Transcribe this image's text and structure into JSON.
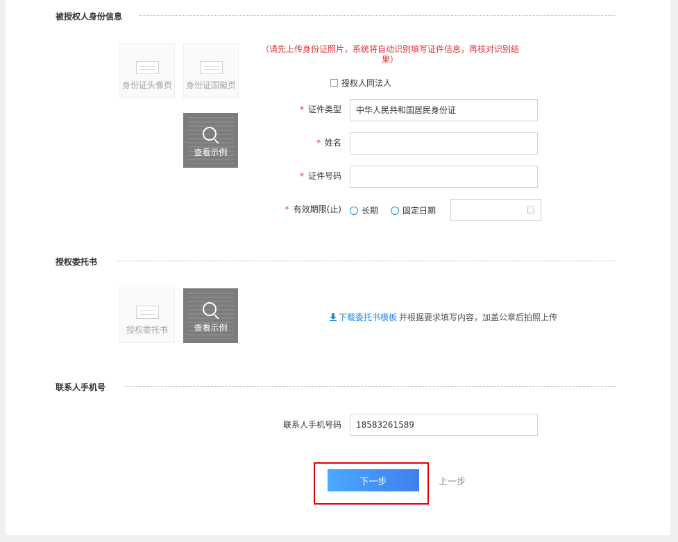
{
  "sections": {
    "authorized_person": "被授权人身份信息",
    "authorization_letter": "授权委托书",
    "contact_phone": "联系人手机号"
  },
  "id_upload": {
    "front_label": "身份证头像页",
    "back_label": "身份证国徽页",
    "example_label": "查看示例",
    "hint": "（请先上传身份证照片，系统将自动识别填写证件信息，再核对识别结果）"
  },
  "form": {
    "same_as_legal_label": "授权人同法人",
    "required_mark": "*",
    "id_type_label": "证件类型",
    "id_type_value": "中华人民共和国居民身份证",
    "name_label": "姓名",
    "name_value": "",
    "id_number_label": "证件号码",
    "id_number_value": "",
    "validity_label": "有效期限(止)",
    "validity_options": [
      "长期",
      "固定日期"
    ],
    "validity_date": ""
  },
  "letter_upload": {
    "upload_label": "授权委托书",
    "example_label": "查看示例",
    "download_link": "下载委托书模板",
    "download_hint": "并根据要求填写内容，加盖公章后拍照上传"
  },
  "contact": {
    "phone_label": "联系人手机号码",
    "phone_value": "18583261589"
  },
  "actions": {
    "next": "下一步",
    "prev": "上一步"
  },
  "colors": {
    "required": "#e0333a",
    "link": "#1e88e5",
    "primary_button": "#4a90f5",
    "highlight": "#e00000"
  }
}
